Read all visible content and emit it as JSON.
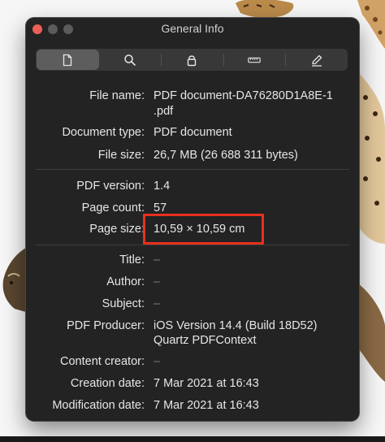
{
  "window": {
    "title": "General Info"
  },
  "toolbar": {
    "items": [
      {
        "name": "document-icon",
        "selected": true
      },
      {
        "name": "search-icon",
        "selected": false
      },
      {
        "name": "lock-icon",
        "selected": false
      },
      {
        "name": "ruler-icon",
        "selected": false
      },
      {
        "name": "pencil-icon",
        "selected": false
      }
    ]
  },
  "info": {
    "file_name": {
      "label": "File name:",
      "value_line1": "PDF document-DA76280D1A8E-1",
      "value_line2": ".pdf"
    },
    "document_type": {
      "label": "Document type:",
      "value": "PDF document"
    },
    "file_size": {
      "label": "File size:",
      "value": "26,7 MB (26 688 311 bytes)"
    },
    "pdf_version": {
      "label": "PDF version:",
      "value": "1.4"
    },
    "page_count": {
      "label": "Page count:",
      "value": "57"
    },
    "page_size": {
      "label": "Page size:",
      "value": "10,59 × 10,59 cm"
    },
    "title": {
      "label": "Title:",
      "value": "–"
    },
    "author": {
      "label": "Author:",
      "value": "–"
    },
    "subject": {
      "label": "Subject:",
      "value": "–"
    },
    "pdf_producer": {
      "label": "PDF Producer:",
      "value_line1": "iOS Version 14.4 (Build 18D52)",
      "value_line2": "Quartz PDFContext"
    },
    "content_creator": {
      "label": "Content creator:",
      "value": "–"
    },
    "creation_date": {
      "label": "Creation date:",
      "value": "7 Mar 2021 at 16:43"
    },
    "modification_date": {
      "label": "Modification date:",
      "value": "7 Mar 2021 at 16:43"
    }
  },
  "colors": {
    "highlight": "#e8301d",
    "window_bg": "#232323",
    "close_button": "#ec5f57"
  }
}
